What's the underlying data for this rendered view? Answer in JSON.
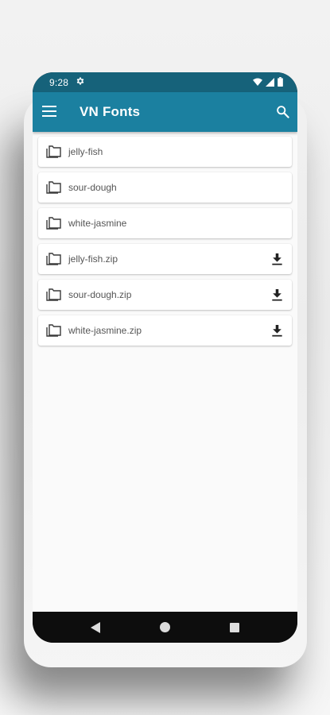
{
  "status_bar": {
    "time": "9:28",
    "icons": [
      "settings-gear-icon",
      "wifi-icon",
      "signal-icon",
      "battery-icon"
    ]
  },
  "app_bar": {
    "title": "VN Fonts",
    "menu_icon": "menu-icon",
    "search_icon": "search-icon",
    "color": "#1b80a0",
    "status_color": "#16627a"
  },
  "list": {
    "items": [
      {
        "label": "jelly-fish",
        "icon": "folder-icon",
        "downloadable": false
      },
      {
        "label": "sour-dough",
        "icon": "folder-icon",
        "downloadable": false
      },
      {
        "label": "white-jasmine",
        "icon": "folder-icon",
        "downloadable": false
      },
      {
        "label": "jelly-fish.zip",
        "icon": "folder-icon",
        "downloadable": true
      },
      {
        "label": "sour-dough.zip",
        "icon": "folder-icon",
        "downloadable": true
      },
      {
        "label": "white-jasmine.zip",
        "icon": "folder-icon",
        "downloadable": true
      }
    ]
  },
  "nav_bar": {
    "icons": [
      "back-icon",
      "home-icon",
      "recents-icon"
    ]
  }
}
